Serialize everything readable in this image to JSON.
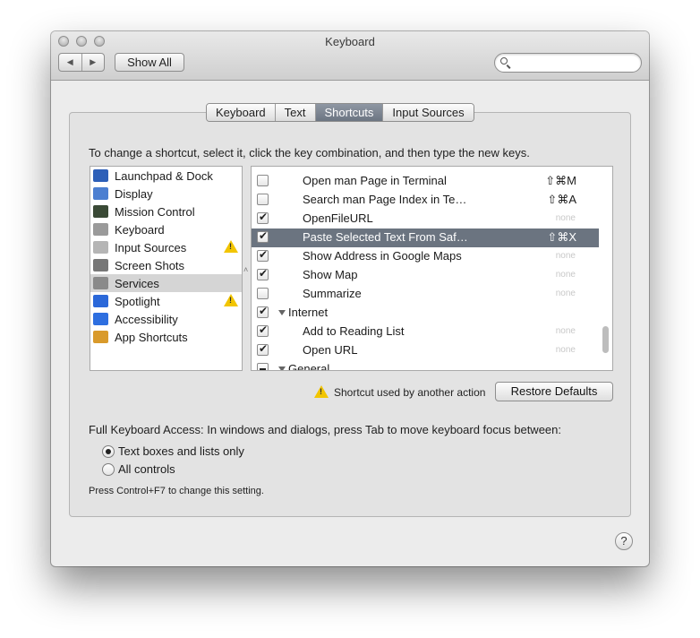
{
  "window": {
    "title": "Keyboard"
  },
  "toolbar": {
    "back": "◀",
    "forward": "▶",
    "show_all": "Show All",
    "search_placeholder": ""
  },
  "tabs": [
    {
      "label": "Keyboard",
      "active": false
    },
    {
      "label": "Text",
      "active": false
    },
    {
      "label": "Shortcuts",
      "active": true
    },
    {
      "label": "Input Sources",
      "active": false
    }
  ],
  "instructions": "To change a shortcut, select it, click the key combination, and then type the new keys.",
  "categories": [
    {
      "label": "Launchpad & Dock",
      "icon": "launchpad-icon",
      "color": "#2d5fb8",
      "warning": false
    },
    {
      "label": "Display",
      "icon": "display-icon",
      "color": "#4c7fd1",
      "warning": false
    },
    {
      "label": "Mission Control",
      "icon": "mission-control-icon",
      "color": "#3a4a36",
      "warning": false
    },
    {
      "label": "Keyboard",
      "icon": "keyboard-icon",
      "color": "#9a9a9a",
      "warning": false
    },
    {
      "label": "Input Sources",
      "icon": "input-sources-icon",
      "color": "#b5b5b5",
      "warning": true
    },
    {
      "label": "Screen Shots",
      "icon": "camera-icon",
      "color": "#777777",
      "warning": false
    },
    {
      "label": "Services",
      "icon": "gear-icon",
      "color": "#8a8a8a",
      "warning": false,
      "selected": true
    },
    {
      "label": "Spotlight",
      "icon": "spotlight-icon",
      "color": "#2b68d9",
      "warning": true
    },
    {
      "label": "Accessibility",
      "icon": "accessibility-icon",
      "color": "#2e6fe0",
      "warning": false
    },
    {
      "label": "App Shortcuts",
      "icon": "app-shortcuts-icon",
      "color": "#d99a2b",
      "warning": false
    }
  ],
  "shortcuts": [
    {
      "type": "item",
      "checked": false,
      "label": "Open man Page in Terminal",
      "key": "⇧⌘M"
    },
    {
      "type": "item",
      "checked": false,
      "label": "Search man Page Index in Te…",
      "key": "⇧⌘A"
    },
    {
      "type": "item",
      "checked": true,
      "label": "OpenFileURL",
      "key": "none"
    },
    {
      "type": "item",
      "checked": true,
      "label": "Paste Selected Text From Saf…",
      "key": "⇧⌘X",
      "selected": true
    },
    {
      "type": "item",
      "checked": true,
      "label": "Show Address in Google Maps",
      "key": "none"
    },
    {
      "type": "item",
      "checked": true,
      "label": "Show Map",
      "key": "none"
    },
    {
      "type": "item",
      "checked": false,
      "label": "Summarize",
      "key": "none"
    },
    {
      "type": "group",
      "checked": true,
      "label": "Internet"
    },
    {
      "type": "item",
      "checked": true,
      "label": "Add to Reading List",
      "key": "none"
    },
    {
      "type": "item",
      "checked": true,
      "label": "Open URL",
      "key": "none"
    },
    {
      "type": "group",
      "checked": "mixed",
      "label": "General"
    }
  ],
  "legend": "Shortcut used by another action",
  "restore_label": "Restore Defaults",
  "full_keyboard_access": {
    "text": "Full Keyboard Access: In windows and dialogs, press Tab to move keyboard focus between:",
    "options": [
      {
        "label": "Text boxes and lists only",
        "selected": true
      },
      {
        "label": "All controls",
        "selected": false
      }
    ],
    "hint": "Press Control+F7 to change this setting."
  },
  "help": "?"
}
